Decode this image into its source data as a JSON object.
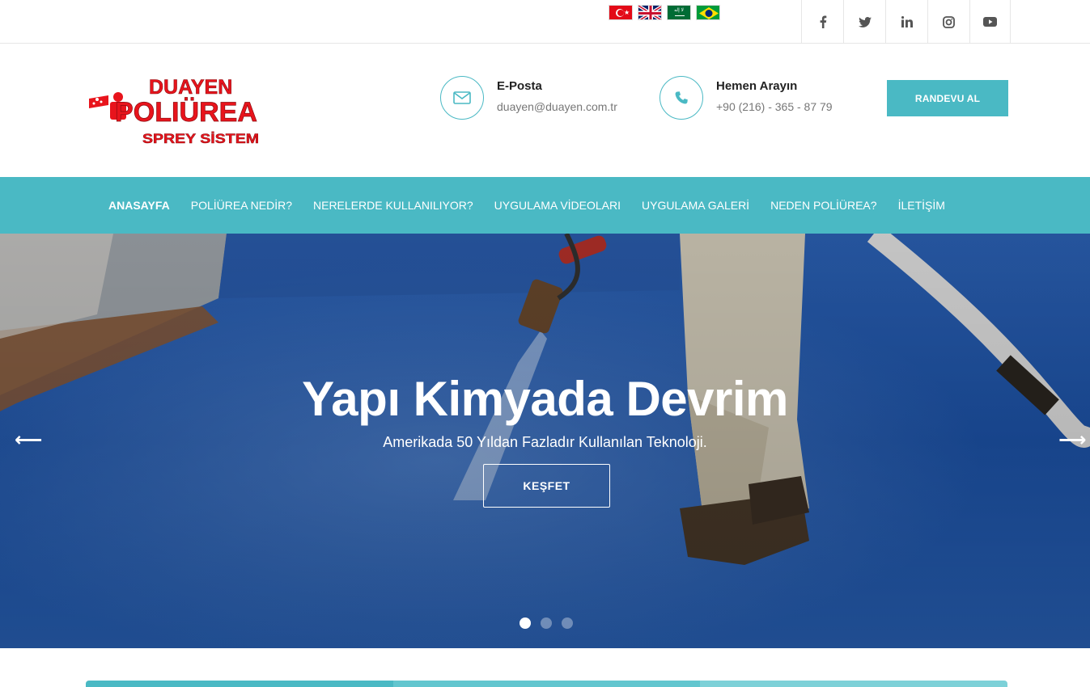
{
  "topbar": {
    "flags": [
      "flag-turkey",
      "flag-uk",
      "flag-saudi-arabia",
      "flag-brazil"
    ],
    "socials": [
      {
        "icon": "facebook-icon",
        "glyph": "f"
      },
      {
        "icon": "twitter-icon",
        "glyph": "t"
      },
      {
        "icon": "linkedin-icon",
        "glyph": "in"
      },
      {
        "icon": "instagram-icon",
        "glyph": "◎"
      },
      {
        "icon": "youtube-icon",
        "glyph": "▶"
      }
    ]
  },
  "logo": {
    "line1": "DUAYEN",
    "line2": "POLIÜREA",
    "line3": "SPREY SİSTEM"
  },
  "contact": {
    "email_label": "E-Posta",
    "email_value": "duayen@duayen.com.tr",
    "phone_label": "Hemen Arayın",
    "phone_value": "+90 (216) - 365 - 87 79"
  },
  "header": {
    "cta": "RANDEVU AL"
  },
  "nav": {
    "items": [
      "ANASAYFA",
      "POLİÜREA NEDİR?",
      "NERELERDE KULLANILIYOR?",
      "UYGULAMA VİDEOLARI",
      "UYGULAMA GALERİ",
      "NEDEN POLİÜREA?",
      "İLETİŞİM"
    ]
  },
  "hero": {
    "title": "Yapı Kimyada Devrim",
    "subtitle": "Amerikada 50 Yıldan Fazladır Kullanılan Teknoloji.",
    "button": "KEŞFET",
    "prev": "⟵",
    "next": "⟶"
  },
  "colors": {
    "accent": "#4ab9c4",
    "logo_red": "#e8141c",
    "hero_blue": "#1e4ea0"
  }
}
